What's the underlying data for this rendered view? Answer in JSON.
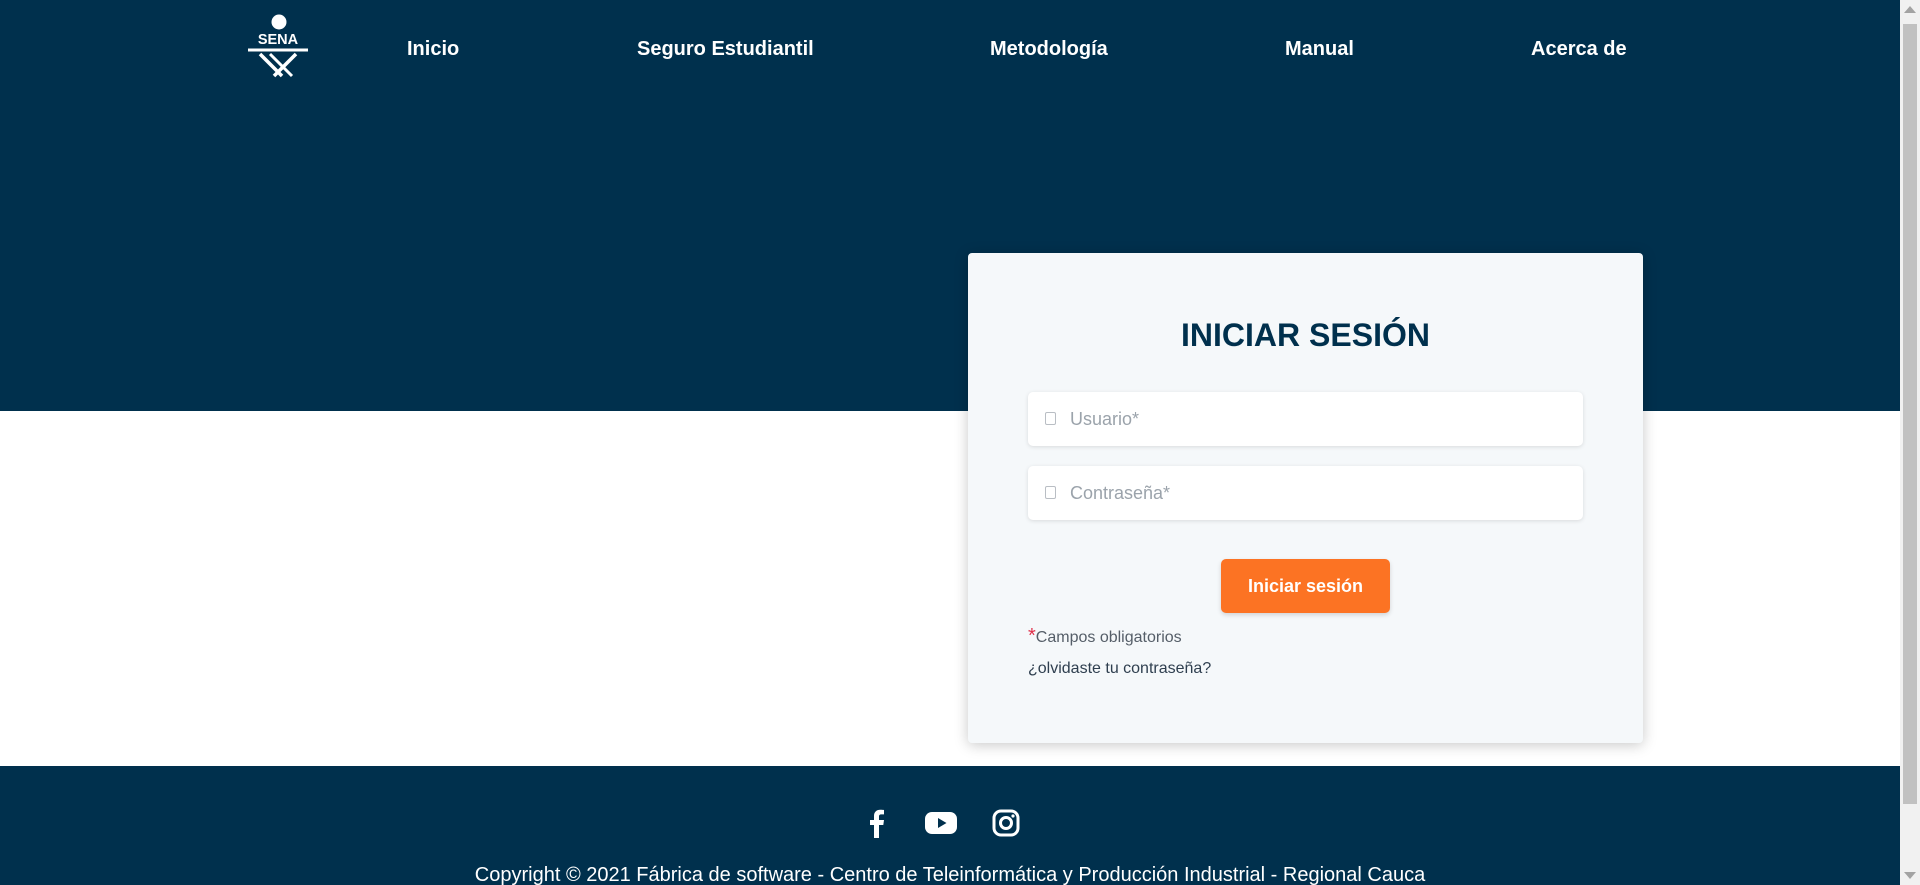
{
  "brand": {
    "logo_text": "SENA"
  },
  "nav": {
    "items": [
      {
        "label": "Inicio"
      },
      {
        "label": "Seguro Estudiantil"
      },
      {
        "label": "Metodología"
      },
      {
        "label": "Manual"
      },
      {
        "label": "Acerca de"
      }
    ]
  },
  "login": {
    "title": "INICIAR SESIÓN",
    "username": {
      "placeholder": "Usuario*",
      "value": "",
      "icon": "user-icon"
    },
    "password": {
      "placeholder": "Contraseña*",
      "value": "",
      "icon": "lock-icon"
    },
    "submit_label": "Iniciar sesión",
    "required_marker": "*",
    "required_text": "Campos obligatorios",
    "forgot_label": "¿olvidaste tu contraseña?"
  },
  "footer": {
    "social": [
      {
        "name": "facebook-icon"
      },
      {
        "name": "youtube-icon"
      },
      {
        "name": "instagram-icon"
      }
    ],
    "copyright": "Copyright © 2021 Fábrica de software - Centro de Teleinformática y Producción Industrial - Regional Cauca"
  },
  "colors": {
    "primary": "#00304d",
    "accent": "#fc7323",
    "card_bg": "#f5f8fa",
    "required_star": "#e0304a"
  }
}
